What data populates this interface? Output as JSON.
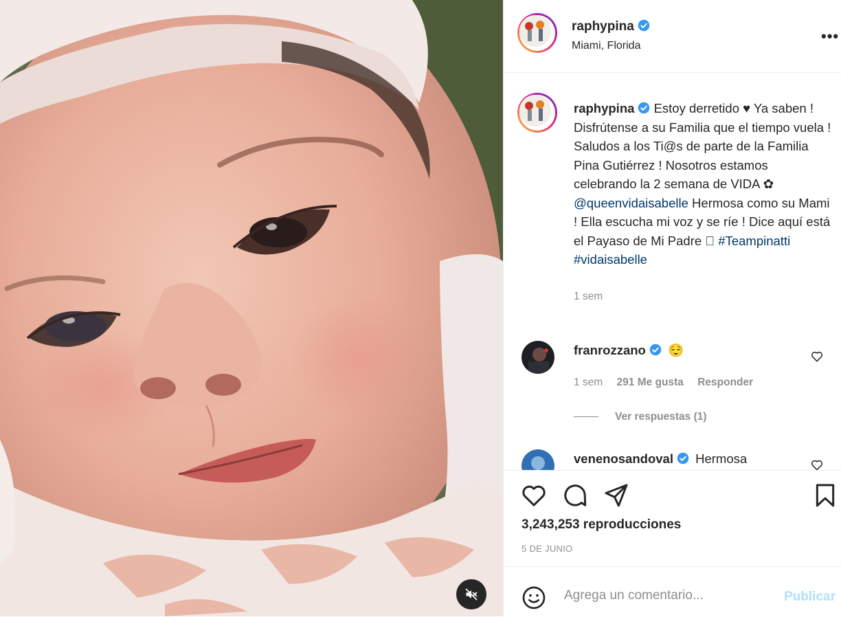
{
  "post": {
    "username": "raphypina",
    "location": "Miami, Florida",
    "caption_text_1": "Estoy derretido ♥ Ya saben ! Disfrútense a su Familia que el tiempo vuela ! Saludos a los Ti@s de parte de la Familia Pina Gutiérrez ! Nosotros estamos celebrando la 2 semana de VIDA ✿ ",
    "caption_mention": "@queenvidaisabelle",
    "caption_text_2": " Hermosa como su Mami ! Ella escucha mi voz y se ríe ! Dice aquí está el Payaso de Mi Padre 􀀀 ",
    "hashtag_1": "#Teampinatti",
    "hashtag_2": "#vidaisabelle",
    "caption_age": "1 sem",
    "views": "3,243,253 reproducciones",
    "date": "5 DE JUNIO"
  },
  "comments": [
    {
      "username": "franrozzano",
      "text": "😌",
      "age": "1 sem",
      "likes": "291 Me gusta",
      "reply": "Responder",
      "view_replies": "Ver respuestas (1)"
    },
    {
      "username": "venenosandoval",
      "text": "Hermosa"
    }
  ],
  "add_comment": {
    "placeholder": "Agrega un comentario...",
    "publish": "Publicar"
  },
  "icons": {
    "more": "more-options-icon",
    "verified": "verified-badge-icon",
    "like": "heart-icon",
    "comment": "comment-icon",
    "share": "send-icon",
    "save": "bookmark-icon",
    "emoji": "emoji-icon",
    "mute": "muted-speaker-icon"
  },
  "colors": {
    "verified": "#3897f0",
    "link": "#00376b",
    "publish_disabled": "#b2dffc"
  }
}
